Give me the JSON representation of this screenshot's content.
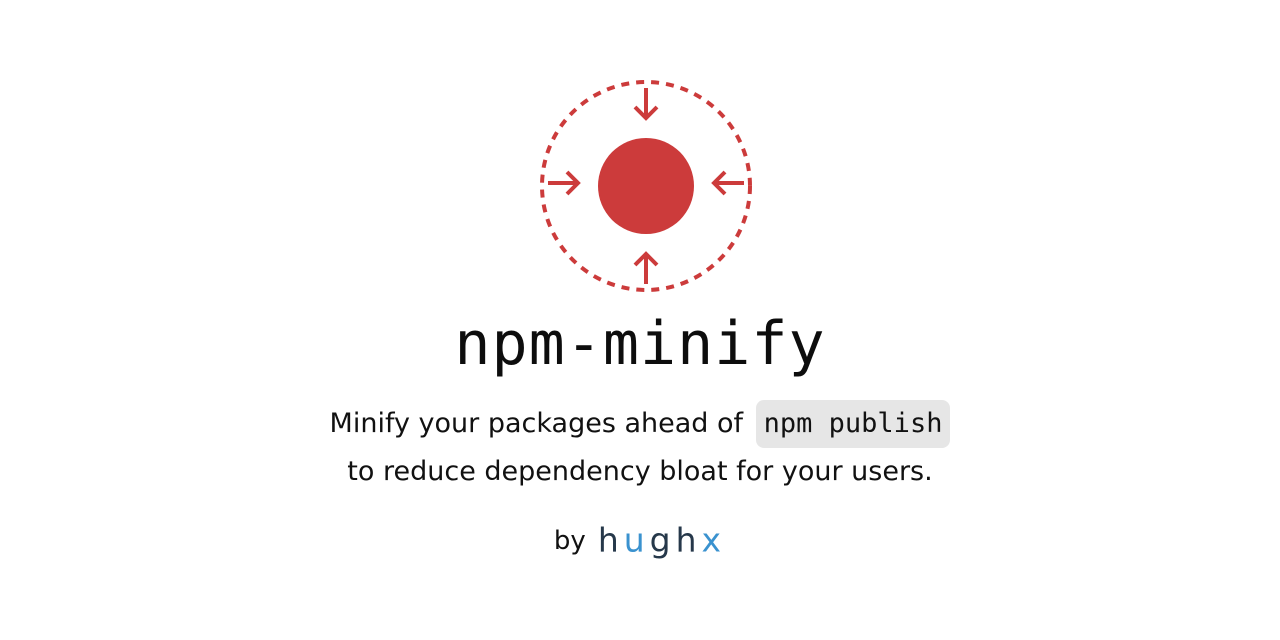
{
  "title": "npm-minify",
  "tagline": {
    "line1_text": "Minify your packages ahead of",
    "line1_code": "npm publish",
    "line2": "to reduce dependency bloat for your users."
  },
  "byline": {
    "prefix": "by",
    "brand_part1": "h",
    "brand_part2": "u",
    "brand_part3": "gh",
    "brand_part4": "x"
  },
  "colors": {
    "accent": "#cc3b3b",
    "brand_dark": "#26384a",
    "brand_blue": "#3a92cf",
    "code_bg": "#e6e6e6"
  },
  "logo": {
    "icon": "minify-compress-icon"
  }
}
